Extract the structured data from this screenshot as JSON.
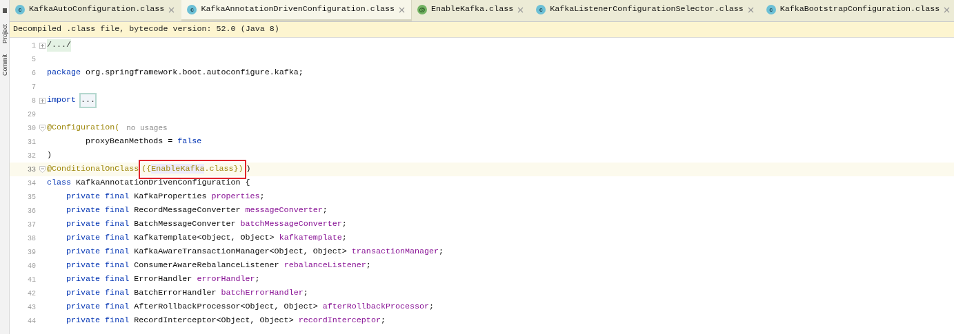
{
  "side_strip": [
    "Project",
    "Commit"
  ],
  "tabs": [
    {
      "badge": "c",
      "kind": "class",
      "label": "KafkaAutoConfiguration.class",
      "selected": false
    },
    {
      "badge": "c",
      "kind": "class",
      "label": "KafkaAnnotationDrivenConfiguration.class",
      "selected": true
    },
    {
      "badge": "@",
      "kind": "annotation",
      "label": "EnableKafka.class",
      "selected": false
    },
    {
      "badge": "c",
      "kind": "class",
      "label": "KafkaListenerConfigurationSelector.class",
      "selected": false
    },
    {
      "badge": "c",
      "kind": "class",
      "label": "KafkaBootstrapConfiguration.class",
      "selected": false
    }
  ],
  "notice": "Decompiled .class file, bytecode version: 52.0 (Java 8)",
  "lines": [
    {
      "number": "1",
      "kind": "fold_closed",
      "current": false,
      "tokens": [
        {
          "kind": "folded",
          "text": "/.../"
        }
      ]
    },
    {
      "number": "5",
      "current": false
    },
    {
      "number": "6",
      "current": false,
      "tokens": [
        {
          "kind": "keyword",
          "text": "package"
        },
        {
          "kind": "plain",
          "text": " org.springframework.boot.autoconfigure.kafka;"
        }
      ]
    },
    {
      "number": "7",
      "current": false
    },
    {
      "number": "8",
      "kind": "fold_closed",
      "current": false,
      "tokens": [
        {
          "kind": "keyword",
          "text": "import"
        },
        {
          "kind": "collapsed",
          "text": "..."
        }
      ]
    },
    {
      "number": "29",
      "current": false
    },
    {
      "number": "30",
      "kind": "fold_open",
      "current": false,
      "tokens": [
        {
          "kind": "annotation",
          "text": "@Configuration("
        },
        {
          "kind": "hint",
          "text": "no usages"
        }
      ],
      "children": [
        {
          "number": "31",
          "current": false,
          "tokens": [
            {
              "kind": "plain",
              "text": "proxyBeanMethods = "
            },
            {
              "kind": "keyword",
              "text": "false"
            }
          ]
        }
      ]
    },
    {
      "number": "32",
      "current": false,
      "tokens": [
        {
          "kind": "plain",
          "text": ")"
        }
      ]
    },
    {
      "number": "33",
      "kind": "fold_open",
      "current": true,
      "tokens": [
        {
          "kind": "annotation",
          "text": "@ConditionalOnClass"
        },
        {
          "kind": "boxed",
          "children": [
            {
              "kind": "annotation",
              "text": "({"
            },
            {
              "kind": "usage",
              "text": "EnableKafka"
            },
            {
              "kind": "annotation",
              "text": ".class})"
            }
          ]
        },
        {
          "kind": "plain",
          "text": ")"
        }
      ]
    },
    {
      "number": "34",
      "current": false,
      "tokens": [
        {
          "kind": "keyword",
          "text": "class"
        },
        {
          "kind": "plain",
          "text": " KafkaAnnotationDrivenConfiguration {"
        }
      ],
      "children": [
        {
          "number": "35",
          "current": false,
          "tokens": [
            {
              "kind": "keyword",
              "text": "private final"
            },
            {
              "kind": "plain",
              "text": " KafkaProperties "
            },
            {
              "kind": "field",
              "text": "properties"
            },
            {
              "kind": "plain",
              "text": ";"
            }
          ]
        },
        {
          "number": "36",
          "current": false,
          "tokens": [
            {
              "kind": "keyword",
              "text": "private final"
            },
            {
              "kind": "plain",
              "text": " RecordMessageConverter "
            },
            {
              "kind": "field",
              "text": "messageConverter"
            },
            {
              "kind": "plain",
              "text": ";"
            }
          ]
        },
        {
          "number": "37",
          "current": false,
          "tokens": [
            {
              "kind": "keyword",
              "text": "private final"
            },
            {
              "kind": "plain",
              "text": " BatchMessageConverter "
            },
            {
              "kind": "field",
              "text": "batchMessageConverter"
            },
            {
              "kind": "plain",
              "text": ";"
            }
          ]
        },
        {
          "number": "38",
          "current": false,
          "tokens": [
            {
              "kind": "keyword",
              "text": "private final"
            },
            {
              "kind": "plain",
              "text": " KafkaTemplate<Object, Object> "
            },
            {
              "kind": "field",
              "text": "kafkaTemplate"
            },
            {
              "kind": "plain",
              "text": ";"
            }
          ]
        },
        {
          "number": "39",
          "current": false,
          "tokens": [
            {
              "kind": "keyword",
              "text": "private final"
            },
            {
              "kind": "plain",
              "text": " KafkaAwareTransactionManager<Object, Object> "
            },
            {
              "kind": "field",
              "text": "transactionManager"
            },
            {
              "kind": "plain",
              "text": ";"
            }
          ]
        },
        {
          "number": "40",
          "current": false,
          "tokens": [
            {
              "kind": "keyword",
              "text": "private final"
            },
            {
              "kind": "plain",
              "text": " ConsumerAwareRebalanceListener "
            },
            {
              "kind": "field",
              "text": "rebalanceListener"
            },
            {
              "kind": "plain",
              "text": ";"
            }
          ]
        },
        {
          "number": "41",
          "current": false,
          "tokens": [
            {
              "kind": "keyword",
              "text": "private final"
            },
            {
              "kind": "plain",
              "text": " ErrorHandler "
            },
            {
              "kind": "field",
              "text": "errorHandler"
            },
            {
              "kind": "plain",
              "text": ";"
            }
          ]
        },
        {
          "number": "42",
          "current": false,
          "tokens": [
            {
              "kind": "keyword",
              "text": "private final"
            },
            {
              "kind": "plain",
              "text": " BatchErrorHandler "
            },
            {
              "kind": "field",
              "text": "batchErrorHandler"
            },
            {
              "kind": "plain",
              "text": ";"
            }
          ]
        },
        {
          "number": "43",
          "current": false,
          "tokens": [
            {
              "kind": "keyword",
              "text": "private final"
            },
            {
              "kind": "plain",
              "text": " AfterRollbackProcessor<Object, Object> "
            },
            {
              "kind": "field",
              "text": "afterRollbackProcessor"
            },
            {
              "kind": "plain",
              "text": ";"
            }
          ]
        },
        {
          "number": "44",
          "current": false,
          "tokens": [
            {
              "kind": "keyword",
              "text": "private final"
            },
            {
              "kind": "plain",
              "text": " RecordInterceptor<Object, Object> "
            },
            {
              "kind": "field",
              "text": "recordInterceptor"
            },
            {
              "kind": "plain",
              "text": ";"
            }
          ]
        }
      ]
    }
  ]
}
